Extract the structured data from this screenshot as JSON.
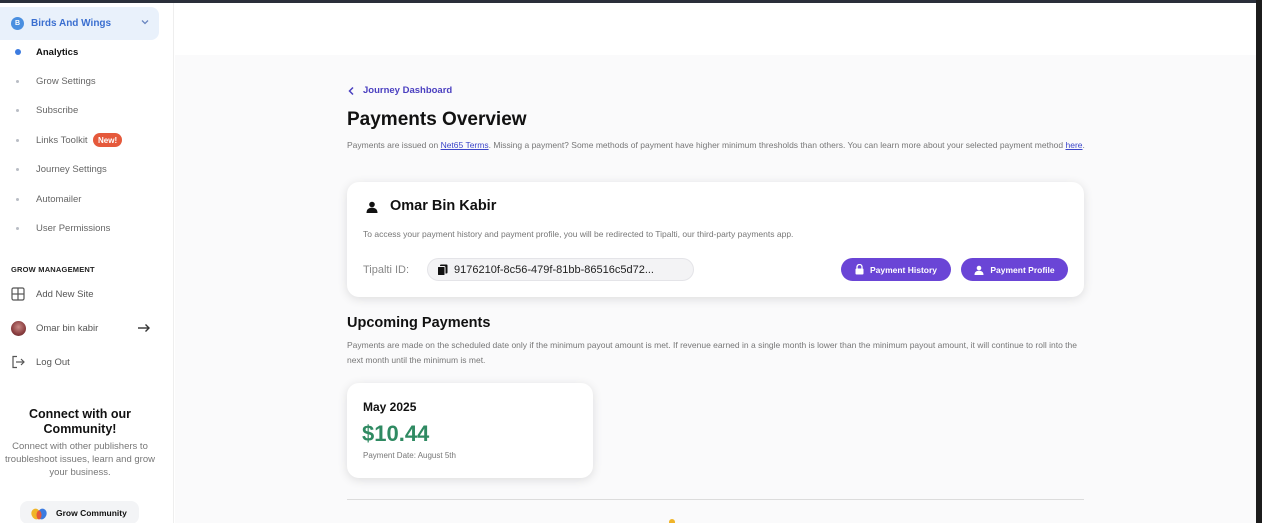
{
  "sidebar": {
    "site": {
      "badge": "B",
      "name": "Birds And Wings"
    },
    "nav": [
      {
        "label": "Analytics",
        "active": true
      },
      {
        "label": "Grow Settings",
        "active": false
      },
      {
        "label": "Subscribe",
        "active": false
      },
      {
        "label": "Links Toolkit",
        "active": false,
        "badge": "New!"
      },
      {
        "label": "Journey Settings",
        "active": false
      },
      {
        "label": "Automailer",
        "active": false
      },
      {
        "label": "User Permissions",
        "active": false
      }
    ],
    "management": {
      "title": "GROW MANAGEMENT",
      "items": [
        {
          "label": "Add New Site",
          "icon": "add-site-icon"
        },
        {
          "label": "Omar bin kabir",
          "icon": "avatar"
        },
        {
          "label": "Log Out",
          "icon": "logout-icon"
        }
      ]
    },
    "community": {
      "title": "Connect with our Community!",
      "text": "Connect with other publishers to troubleshoot issues, learn and grow your business.",
      "button": "Grow Community"
    }
  },
  "main": {
    "back_label": "Journey Dashboard",
    "title": "Payments Overview",
    "intro": {
      "part1": "Payments are issued on ",
      "link1": "Net65 Terms",
      "part2": ". Missing a payment? Some methods of payment have higher minimum thresholds than others. You can learn more about your selected payment method ",
      "link2": "here",
      "part3": "."
    },
    "account": {
      "name": "Omar Bin Kabir",
      "note": "To access your payment history and payment profile, you will be redirected to Tipalti, our third-party payments app.",
      "tipalti_label": "Tipalti ID:",
      "tipalti_id": "9176210f-8c56-479f-81bb-86516c5d72...",
      "history_button": "Payment History",
      "profile_button": "Payment Profile"
    },
    "upcoming": {
      "title": "Upcoming Payments",
      "note": "Payments are made on the scheduled date only if the minimum payout amount is met. If revenue earned in a single month is lower than the minimum payout amount, it will continue to roll into the next month until the minimum is met.",
      "payment": {
        "month": "May 2025",
        "amount": "$10.44",
        "date": "Payment Date: August 5th"
      }
    }
  },
  "colors": {
    "accent": "#6a45d6",
    "amount": "#2f8a62",
    "link": "#3b45c9",
    "new_badge": "#e5593b"
  }
}
